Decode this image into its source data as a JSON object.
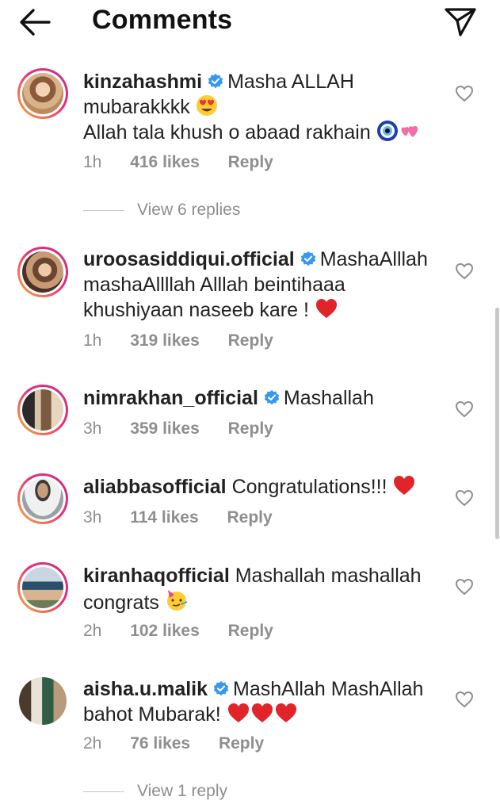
{
  "header": {
    "title": "Comments",
    "back_icon": "arrow-left-icon",
    "send_icon": "paper-plane-icon"
  },
  "colors": {
    "verified": "#3897f0",
    "heart_red": "#e0242a",
    "meta_gray": "#8e8e8e",
    "ring_start": "#f9b233",
    "ring_end": "#c13584"
  },
  "comments": [
    {
      "username": "kinzahashmi",
      "verified": true,
      "line1": "Masha ALLAH",
      "line2": "mubarakkkk",
      "line3": "Allah tala khush o abaad rakhain",
      "time": "1h",
      "likes": "416 likes",
      "reply": "Reply",
      "view_replies": "View 6 replies"
    },
    {
      "username": "uroosasiddiqui.official",
      "verified": true,
      "line1": "MashaAlllah",
      "line2": "mashaAllllah Alllah beintihaaa",
      "line3": "khushiyaan naseeb kare !",
      "time": "1h",
      "likes": "319 likes",
      "reply": "Reply"
    },
    {
      "username": "nimrakhan_official",
      "verified": true,
      "line1": "Mashallah",
      "time": "3h",
      "likes": "359 likes",
      "reply": "Reply"
    },
    {
      "username": "aliabbasofficial",
      "verified": false,
      "line1": "Congratulations!!!",
      "time": "3h",
      "likes": "114 likes",
      "reply": "Reply"
    },
    {
      "username": "kiranhaqofficial",
      "verified": false,
      "line1": "Mashallah mashallah",
      "line2": "congrats",
      "time": "2h",
      "likes": "102 likes",
      "reply": "Reply"
    },
    {
      "username": "aisha.u.malik",
      "verified": true,
      "line1": "MashAllah MashAllah",
      "line2": "bahot Mubarak!",
      "time": "2h",
      "likes": "76 likes",
      "reply": "Reply",
      "view_replies": "View 1 reply"
    }
  ]
}
